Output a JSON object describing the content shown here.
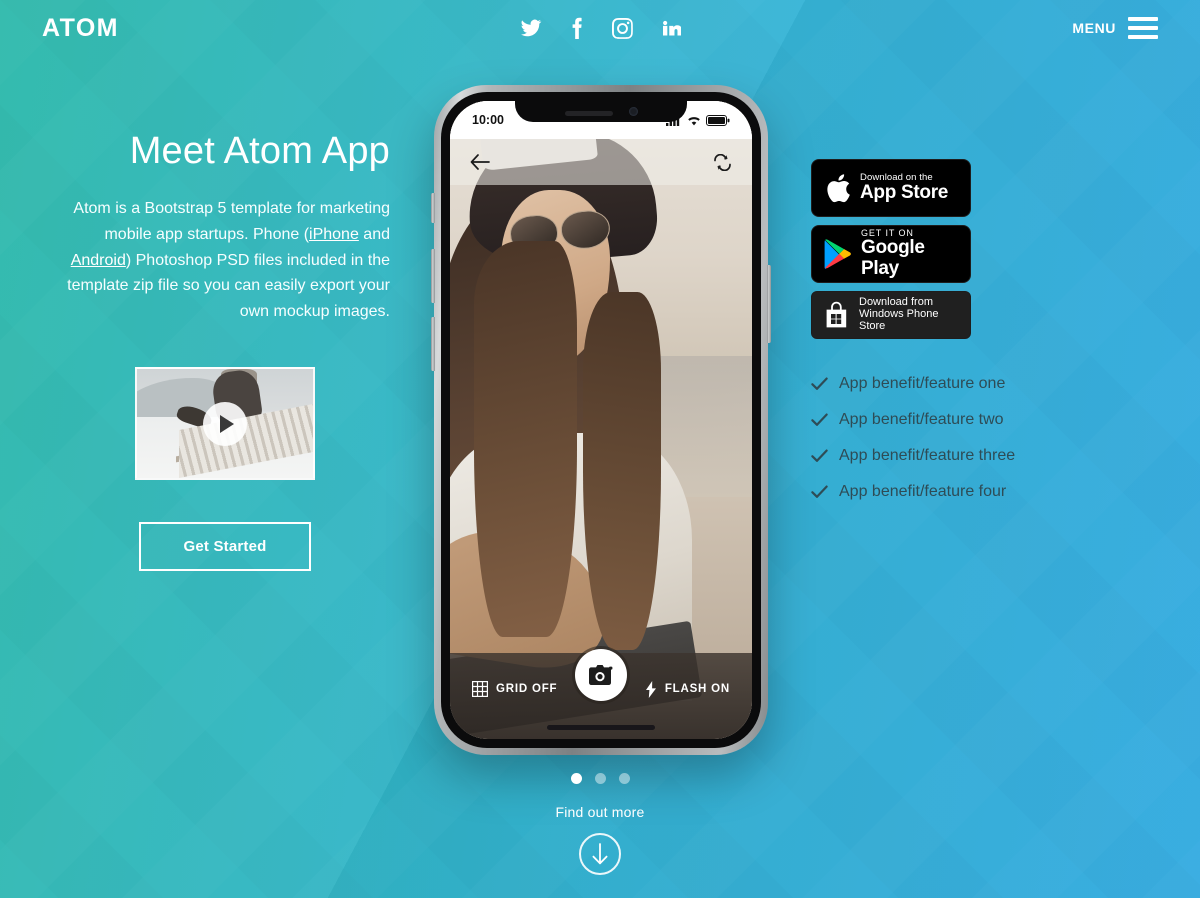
{
  "header": {
    "brand": "ATOM",
    "menu_label": "MENU",
    "social": [
      {
        "name": "twitter-icon",
        "label": "Twitter"
      },
      {
        "name": "facebook-icon",
        "label": "Facebook"
      },
      {
        "name": "instagram-icon",
        "label": "Instagram"
      },
      {
        "name": "linkedin-icon",
        "label": "LinkedIn"
      }
    ]
  },
  "hero": {
    "headline": "Meet Atom App",
    "paragraph_part1": "Atom is a Bootstrap 5 template for marketing mobile app startups. Phone (",
    "link_iphone": "iPhone",
    "paragraph_and": " and ",
    "link_android": "Android",
    "paragraph_part2": ") Photoshop PSD files included in the template zip file so you can easily export your own mockup images.",
    "cta_label": "Get Started",
    "video_alt": "Person jumping on a wooden dock"
  },
  "badges": [
    {
      "name": "app-store-badge",
      "icon": "apple-icon",
      "small": "Download on the",
      "big": "App Store"
    },
    {
      "name": "google-play-badge",
      "icon": "google-play-icon",
      "small": "GET IT ON",
      "big": "Google Play"
    },
    {
      "name": "windows-phone-store-badge",
      "icon": "windows-store-icon",
      "line1": "Download from",
      "line2": "Windows Phone Store"
    }
  ],
  "features": [
    "App benefit/feature one",
    "App benefit/feature two",
    "App benefit/feature three",
    "App benefit/feature four"
  ],
  "phone": {
    "status_time": "10:00",
    "status_icons": [
      "signal-icon",
      "wifi-icon",
      "battery-icon"
    ],
    "nav_back_icon": "back-arrow-icon",
    "nav_switch_icon": "switch-camera-icon",
    "grid_label": "GRID OFF",
    "grid_icon": "grid-icon",
    "flash_label": "FLASH ON",
    "flash_icon": "lightning-bolt-icon",
    "shutter_icon": "camera-icon"
  },
  "footer": {
    "dots": [
      {
        "active": true
      },
      {
        "active": false
      },
      {
        "active": false
      }
    ],
    "find_out_more": "Find out more",
    "scroll_icon": "arrow-down-icon"
  },
  "colors": {
    "gradient_start": "#2bb8aa",
    "gradient_end": "#3bb3e8",
    "text_light": "#ffffff",
    "feature_text": "#2e4c56",
    "badge_bg": "#000000"
  }
}
